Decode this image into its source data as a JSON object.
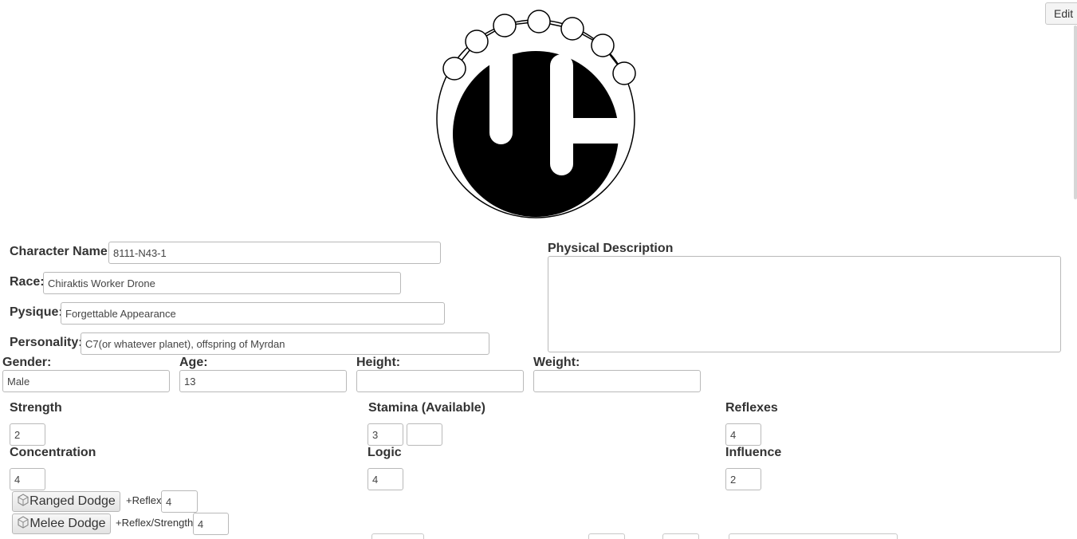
{
  "toolbar": {
    "edit_label": "Edit"
  },
  "logo": {
    "icon": "chiraktis-emblem-icon"
  },
  "fields": {
    "character_name": {
      "label": "Character Name:",
      "value": "8111-N43-1"
    },
    "race": {
      "label": "Race:",
      "value": "Chiraktis Worker Drone"
    },
    "physique": {
      "label": "Pysique:",
      "value": "Forgettable Appearance"
    },
    "personality": {
      "label": "Personality:",
      "value": "C7(or whatever planet), offspring of Myrdan"
    },
    "physical_description": {
      "label": "Physical Description",
      "value": ""
    },
    "gender": {
      "label": "Gender:",
      "value": "Male"
    },
    "age": {
      "label": "Age:",
      "value": "13"
    },
    "height": {
      "label": "Height:",
      "value": ""
    },
    "weight": {
      "label": "Weight:",
      "value": ""
    }
  },
  "stats": {
    "strength": {
      "label": "Strength",
      "value": "2"
    },
    "stamina": {
      "label": "Stamina (Available)",
      "value": "3",
      "available": ""
    },
    "reflexes": {
      "label": "Reflexes",
      "value": "4"
    },
    "concentration": {
      "label": "Concentration",
      "value": "4"
    },
    "logic": {
      "label": "Logic",
      "value": "4"
    },
    "influence": {
      "label": "Influence",
      "value": "2"
    }
  },
  "dodges": {
    "ranged": {
      "button": "Ranged Dodge",
      "modifier": "+Reflex",
      "value": "4"
    },
    "melee": {
      "button": "Melee Dodge",
      "modifier": "+Reflex/Strength",
      "value": "4"
    }
  },
  "colors": {
    "logo_fill": "#000000",
    "border": "#b9b9b9",
    "text": "#333333"
  }
}
